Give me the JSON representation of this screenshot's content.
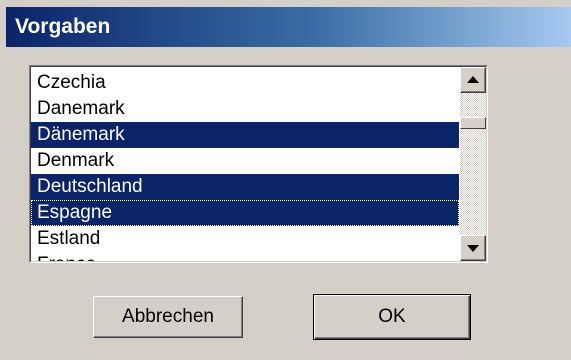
{
  "window": {
    "title": "Vorgaben"
  },
  "list": {
    "items": [
      {
        "label": "Czechia",
        "selected": false
      },
      {
        "label": "Danemark",
        "selected": false
      },
      {
        "label": "Dänemark",
        "selected": true
      },
      {
        "label": "Denmark",
        "selected": false
      },
      {
        "label": "Deutschland",
        "selected": true
      },
      {
        "label": "Espagne",
        "selected": true,
        "focused": true
      },
      {
        "label": "Estland",
        "selected": false
      },
      {
        "label": "France",
        "selected": false
      }
    ],
    "scroll_up_icon": "scroll-up-arrow-icon",
    "scroll_down_icon": "scroll-down-arrow-icon"
  },
  "buttons": {
    "cancel_label": "Abbrechen",
    "ok_label": "OK"
  },
  "colors": {
    "selection": "#0a246a",
    "titlebar_start": "#0a246a",
    "titlebar_end": "#a6caf0",
    "face": "#d4d0c8"
  }
}
